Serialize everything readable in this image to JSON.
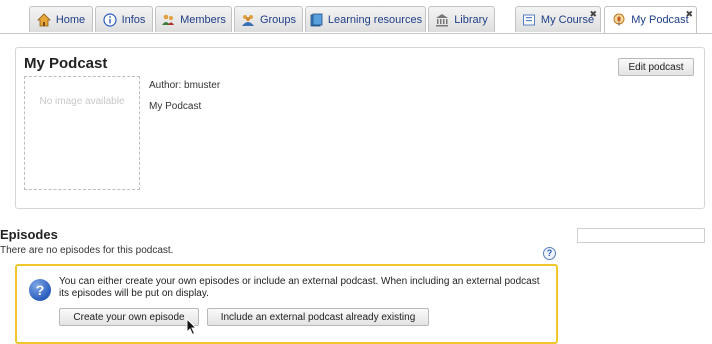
{
  "tabs": [
    {
      "label": "Home",
      "icon": "home-icon"
    },
    {
      "label": "Infos",
      "icon": "info-icon"
    },
    {
      "label": "Members",
      "icon": "members-icon"
    },
    {
      "label": "Groups",
      "icon": "groups-icon"
    },
    {
      "label": "Learning resources",
      "icon": "books-icon"
    },
    {
      "label": "Library",
      "icon": "library-icon"
    },
    {
      "label": "My Course",
      "icon": "course-icon",
      "closable": true
    },
    {
      "label": "My Podcast",
      "icon": "podcast-icon",
      "closable": true,
      "active": true
    }
  ],
  "podcast": {
    "title": "My Podcast",
    "no_image": "No image available",
    "author": "Author: bmuster",
    "name": "My Podcast",
    "edit_label": "Edit podcast"
  },
  "episodes": {
    "title": "Episodes",
    "empty_text": "There are no episodes for this podcast.",
    "help_glyph": "?",
    "info_text": "You can either create your own episodes or include an external podcast. When including an external podcast its episodes will be put on display.",
    "create_label": "Create your own episode",
    "include_label": "Include an external podcast already existing"
  },
  "close_glyph": "✖",
  "colors": {
    "accent": "#f0c62a",
    "link": "#1f3f86"
  }
}
